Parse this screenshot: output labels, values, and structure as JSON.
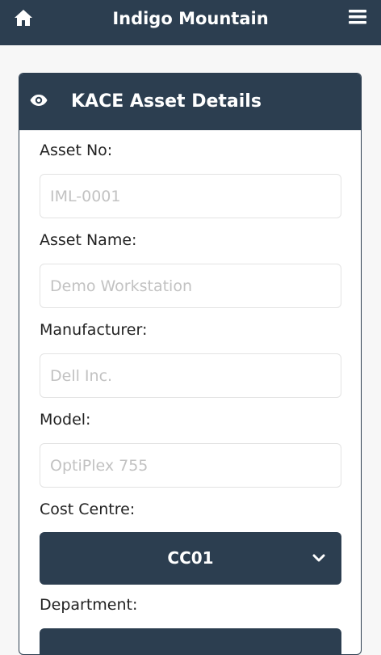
{
  "header": {
    "title": "Indigo Mountain",
    "home_icon": "home-icon",
    "menu_icon": "hamburger-menu-icon"
  },
  "card": {
    "title": "KACE Asset Details",
    "icon": "eye-icon"
  },
  "fields": {
    "asset_no": {
      "label": "Asset No:",
      "placeholder": "IML-0001"
    },
    "asset_name": {
      "label": "Asset Name:",
      "placeholder": "Demo Workstation"
    },
    "manufacturer": {
      "label": "Manufacturer:",
      "placeholder": "Dell Inc."
    },
    "model": {
      "label": "Model:",
      "placeholder": "OptiPlex 755"
    },
    "cost_centre": {
      "label": "Cost Centre:",
      "value": "CC01"
    },
    "department": {
      "label": "Department:"
    }
  },
  "colors": {
    "primary": "#2c3e50",
    "background": "#f7f7f7",
    "placeholder": "#c2c2c2"
  }
}
